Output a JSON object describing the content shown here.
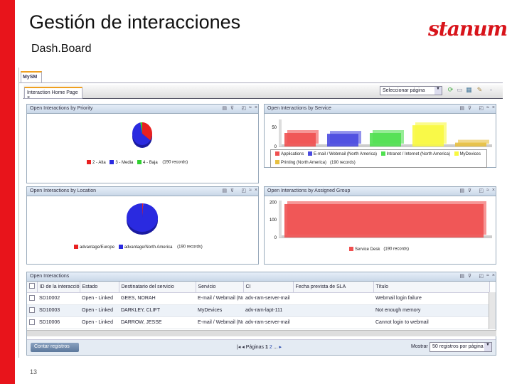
{
  "slide": {
    "title": "Gestión de interacciones",
    "subtitle": "Dash.Board",
    "logo": "stanum",
    "page_number": "13",
    "accent": "#e8141b"
  },
  "app": {
    "main_tab": "MySM",
    "page_tab": "Interaction Home Page",
    "page_tab_close": "×",
    "page_select": "Seleccionar página",
    "toolbar_icons": [
      "refresh-icon",
      "export-icon",
      "layout-icon",
      "new-page-icon",
      "delete-icon"
    ]
  },
  "panels": {
    "priority": {
      "title": "Open Interactions by Priority",
      "records": "(190 records)"
    },
    "service": {
      "title": "Open Interactions by Service",
      "records": "(190 records)"
    },
    "location": {
      "title": "Open Interactions by Location",
      "records": "(190 records)"
    },
    "group": {
      "title": "Open Interactions by Assigned Group",
      "records": "(190 records)"
    },
    "table": {
      "title": "Open Interactions"
    }
  },
  "chart_data": [
    {
      "type": "pie",
      "series": [
        {
          "name": "2 - Alta",
          "value": 35,
          "color": "#e82020"
        },
        {
          "name": "3 - Media",
          "value": 62,
          "color": "#2a2ae0"
        },
        {
          "name": "4 - Baja",
          "value": 3,
          "color": "#30d030"
        }
      ]
    },
    {
      "type": "bar",
      "categories": [
        "Applications",
        "E-mail / Webmail (North America)",
        "Intranet / Internet (North America)",
        "MyDevices",
        "Printing (North America)"
      ],
      "values": [
        35,
        33,
        35,
        55,
        10
      ],
      "colors": [
        "#f05050",
        "#4a4ae0",
        "#50e050",
        "#f8f840",
        "#e8c040"
      ],
      "yticks": [
        "0",
        "50"
      ],
      "ylim": [
        0,
        70
      ]
    },
    {
      "type": "pie",
      "series": [
        {
          "name": "advantage/Europe",
          "value": 1,
          "color": "#e82020"
        },
        {
          "name": "advantage/North America",
          "value": 99,
          "color": "#2a2ae0"
        }
      ]
    },
    {
      "type": "bar",
      "categories": [
        "Service Desk"
      ],
      "values": [
        190
      ],
      "colors": [
        "#f05050"
      ],
      "yticks": [
        "0",
        "100",
        "200"
      ],
      "ylim": [
        0,
        210
      ]
    }
  ],
  "table": {
    "columns": [
      "ID de la interacción",
      "Estado",
      "Destinatario del servicio",
      "Servicio",
      "CI",
      "Fecha prevista de SLA",
      "Título"
    ],
    "rows": [
      [
        "SD10002",
        "Open - Linked",
        "GEES, NORAH",
        "E-mail / Webmail (North",
        "adv-ram-server-mail",
        "",
        "Webmail login failure"
      ],
      [
        "SD10003",
        "Open - Linked",
        "DARKLEY, CLIFT",
        "MyDevices",
        "adv-ram-lapt-111",
        "",
        "Not enough memory"
      ],
      [
        "SD10006",
        "Open - Linked",
        "DARROW, JESSE",
        "E-mail / Webmail (North",
        "adv-ram-server-mail",
        "",
        "Cannot login to webmail"
      ]
    ],
    "count_button": "Contar registros",
    "pages_label": "Páginas",
    "pages": [
      "1",
      "2",
      "..."
    ],
    "show_label": "Mostrar",
    "show_value": "50 registros por página"
  }
}
